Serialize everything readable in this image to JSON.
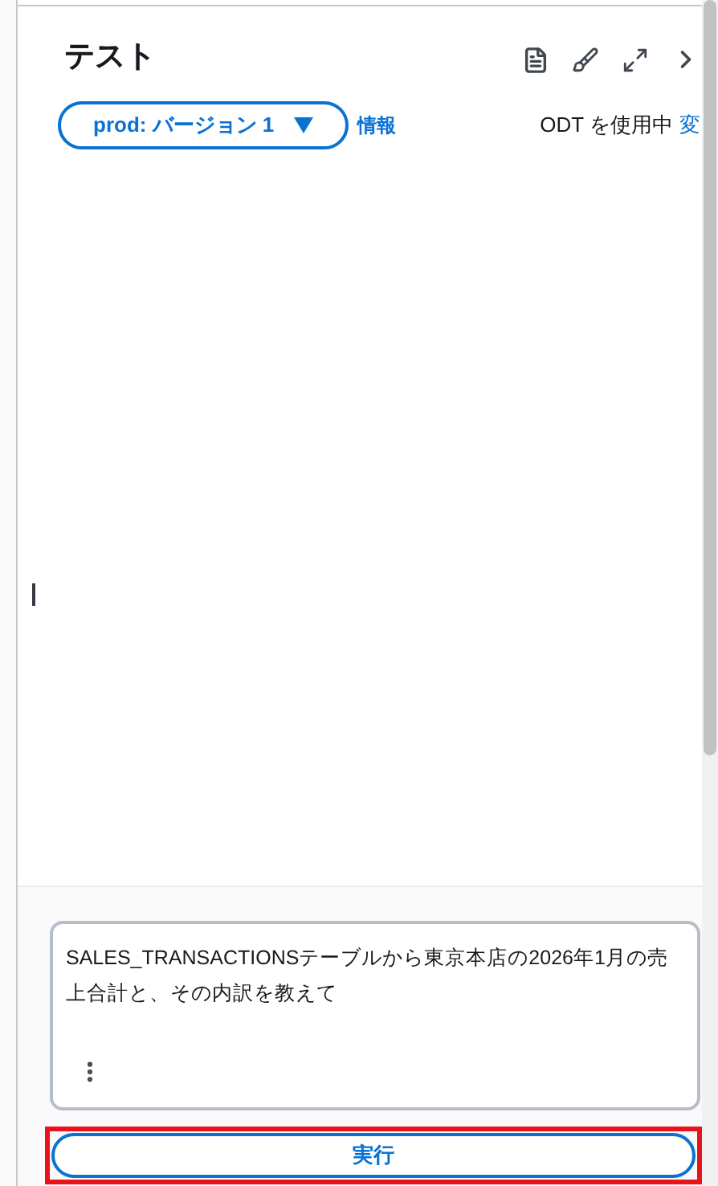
{
  "panel": {
    "title": "テスト",
    "version_select": "prod: バージョン 1",
    "info_link": "情報",
    "status": "ODT を使用中",
    "change_link": "変"
  },
  "prompt": {
    "value": "SALES_TRANSACTIONSテーブルから東京本店の2026年1月の売上合計と、その内訳を教えて"
  },
  "run_button": {
    "label": "実行",
    "highlighted": true
  }
}
